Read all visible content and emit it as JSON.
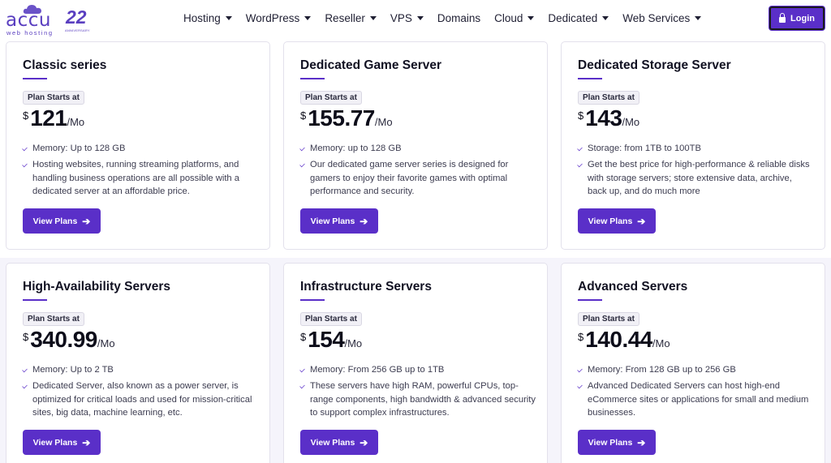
{
  "header": {
    "logo_text": "accu",
    "logo_subtext": "web hosting",
    "anniversary_number": "22",
    "anniversary_label": "ANNIVERSARY",
    "nav": [
      {
        "label": "Hosting",
        "dropdown": true
      },
      {
        "label": "WordPress",
        "dropdown": true
      },
      {
        "label": "Reseller",
        "dropdown": true
      },
      {
        "label": "VPS",
        "dropdown": true
      },
      {
        "label": "Domains",
        "dropdown": false
      },
      {
        "label": "Cloud",
        "dropdown": true
      },
      {
        "label": "Dedicated",
        "dropdown": true
      },
      {
        "label": "Web Services",
        "dropdown": true
      }
    ],
    "login_label": "Login",
    "login_icon": "lock-icon"
  },
  "colors": {
    "accent": "#5a2fc8",
    "text": "#111122",
    "lower_background": "#f5f4fb"
  },
  "cards": [
    {
      "title": "Classic series",
      "plan_label": "Plan Starts at",
      "currency": "$",
      "price": "121",
      "period": "/Mo",
      "features": [
        "Memory: Up to 128 GB",
        "Hosting websites, running streaming platforms, and handling business operations are all possible with a dedicated server at an affordable price."
      ],
      "button": "View Plans"
    },
    {
      "title": "Dedicated Game Server",
      "plan_label": "Plan Starts at",
      "currency": "$",
      "price": "155.77",
      "period": "/Mo",
      "features": [
        "Memory: up to 128 GB",
        "Our dedicated game server series is designed for gamers to enjoy their favorite games with optimal performance and security."
      ],
      "button": "View Plans"
    },
    {
      "title": "Dedicated Storage Server",
      "plan_label": "Plan Starts at",
      "currency": "$",
      "price": "143",
      "period": "/Mo",
      "features": [
        "Storage: from 1TB to 100TB",
        "Get the best price for high-performance & reliable disks with storage servers; store extensive data, archive, back up, and do much more"
      ],
      "button": "View Plans"
    },
    {
      "title": "High-Availability Servers",
      "plan_label": "Plan Starts at",
      "currency": "$",
      "price": "340.99",
      "period": "/Mo",
      "features": [
        "Memory: Up to 2 TB",
        "Dedicated Server, also known as a power server, is optimized for critical loads and used for mission-critical sites, big data, machine learning, etc."
      ],
      "button": "View Plans"
    },
    {
      "title": "Infrastructure Servers",
      "plan_label": "Plan Starts at",
      "currency": "$",
      "price": "154",
      "period": "/Mo",
      "features": [
        "Memory: From 256 GB up to 1TB",
        "These servers have high RAM, powerful CPUs, top-range components, high bandwidth & advanced security to support complex infrastructures."
      ],
      "button": "View Plans"
    },
    {
      "title": "Advanced Servers",
      "plan_label": "Plan Starts at",
      "currency": "$",
      "price": "140.44",
      "period": "/Mo",
      "features": [
        "Memory: From 128 GB up to 256 GB",
        "Advanced Dedicated Servers can host high-end eCommerce sites or applications for small and medium businesses."
      ],
      "button": "View Plans"
    }
  ]
}
